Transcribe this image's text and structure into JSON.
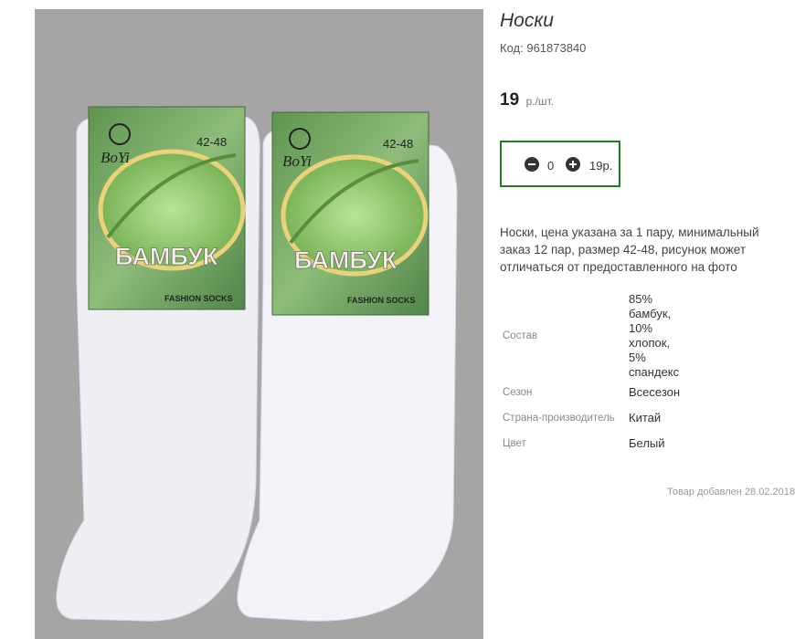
{
  "product": {
    "title": "Носки",
    "code_label": "Код:",
    "code_value": "961873840",
    "price_value": "19",
    "price_unit": "р./шт.",
    "quantity": "0",
    "total": "19р.",
    "description": "Носки, цена указана за 1 пару, минимальный заказ 12 пар, размер 42-48, рисунок может отличаться от предоставленного на фото",
    "added": "Товар добавлен 28.02.2018"
  },
  "properties": [
    {
      "key": "Состав",
      "value": "85% бамбук, 10% хлопок, 5% спандекс"
    },
    {
      "key": "Сезон",
      "value": "Всесезон"
    },
    {
      "key": "Страна-производитель",
      "value": "Китай"
    },
    {
      "key": "Цвет",
      "value": "Белый"
    }
  ],
  "image": {
    "label_brand": "BoYi",
    "label_size": "42-48",
    "label_text": "БАМБУК",
    "label_tagline": "FASHION SOCKS",
    "background_color": "#a6a4a5",
    "label_color": "#6d9f5a"
  }
}
